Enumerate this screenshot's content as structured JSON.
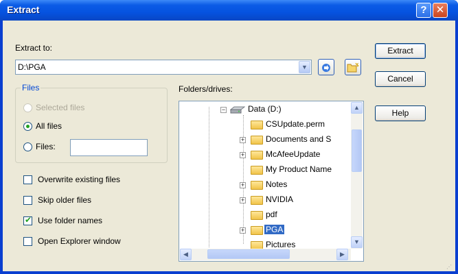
{
  "window": {
    "title": "Extract",
    "help_button": "?",
    "close_button": "✕"
  },
  "extract_to": {
    "label": "Extract to:",
    "path": "D:\\PGA"
  },
  "buttons": {
    "extract": "Extract",
    "cancel": "Cancel",
    "help": "Help"
  },
  "files_group": {
    "title": "Files",
    "options": {
      "selected": "Selected files",
      "all": "All files",
      "files": "Files:"
    },
    "selected_option": "All files",
    "files_value": ""
  },
  "checkboxes": {
    "overwrite": {
      "label": "Overwrite existing files",
      "checked": false
    },
    "skip_older": {
      "label": "Skip older files",
      "checked": false
    },
    "use_folder_names": {
      "label": "Use folder names",
      "checked": true
    },
    "open_explorer": {
      "label": "Open Explorer window",
      "checked": false
    }
  },
  "folders": {
    "label": "Folders/drives:",
    "drive": "Data (D:)",
    "items": [
      {
        "name": "CSUpdate.perm",
        "expandable": false
      },
      {
        "name": "Documents and S",
        "expandable": true
      },
      {
        "name": "McAfeeUpdate",
        "expandable": true
      },
      {
        "name": "My Product Name",
        "expandable": false
      },
      {
        "name": "Notes",
        "expandable": true
      },
      {
        "name": "NVIDIA",
        "expandable": true
      },
      {
        "name": "pdf",
        "expandable": false
      },
      {
        "name": "PGA",
        "expandable": true,
        "selected": true
      },
      {
        "name": "Pictures",
        "expandable": false
      }
    ]
  },
  "icons": {
    "refresh": "refresh-icon",
    "new_folder": "new-folder-icon",
    "chevron_down": "▼",
    "chevron_up": "▲",
    "arrow_left": "◀",
    "arrow_right": "▶",
    "expand": "+",
    "collapse": "−",
    "check": "✔"
  },
  "colors": {
    "titlebar": "#0553e0",
    "selection": "#316ac5",
    "group_title": "#0046d5"
  }
}
